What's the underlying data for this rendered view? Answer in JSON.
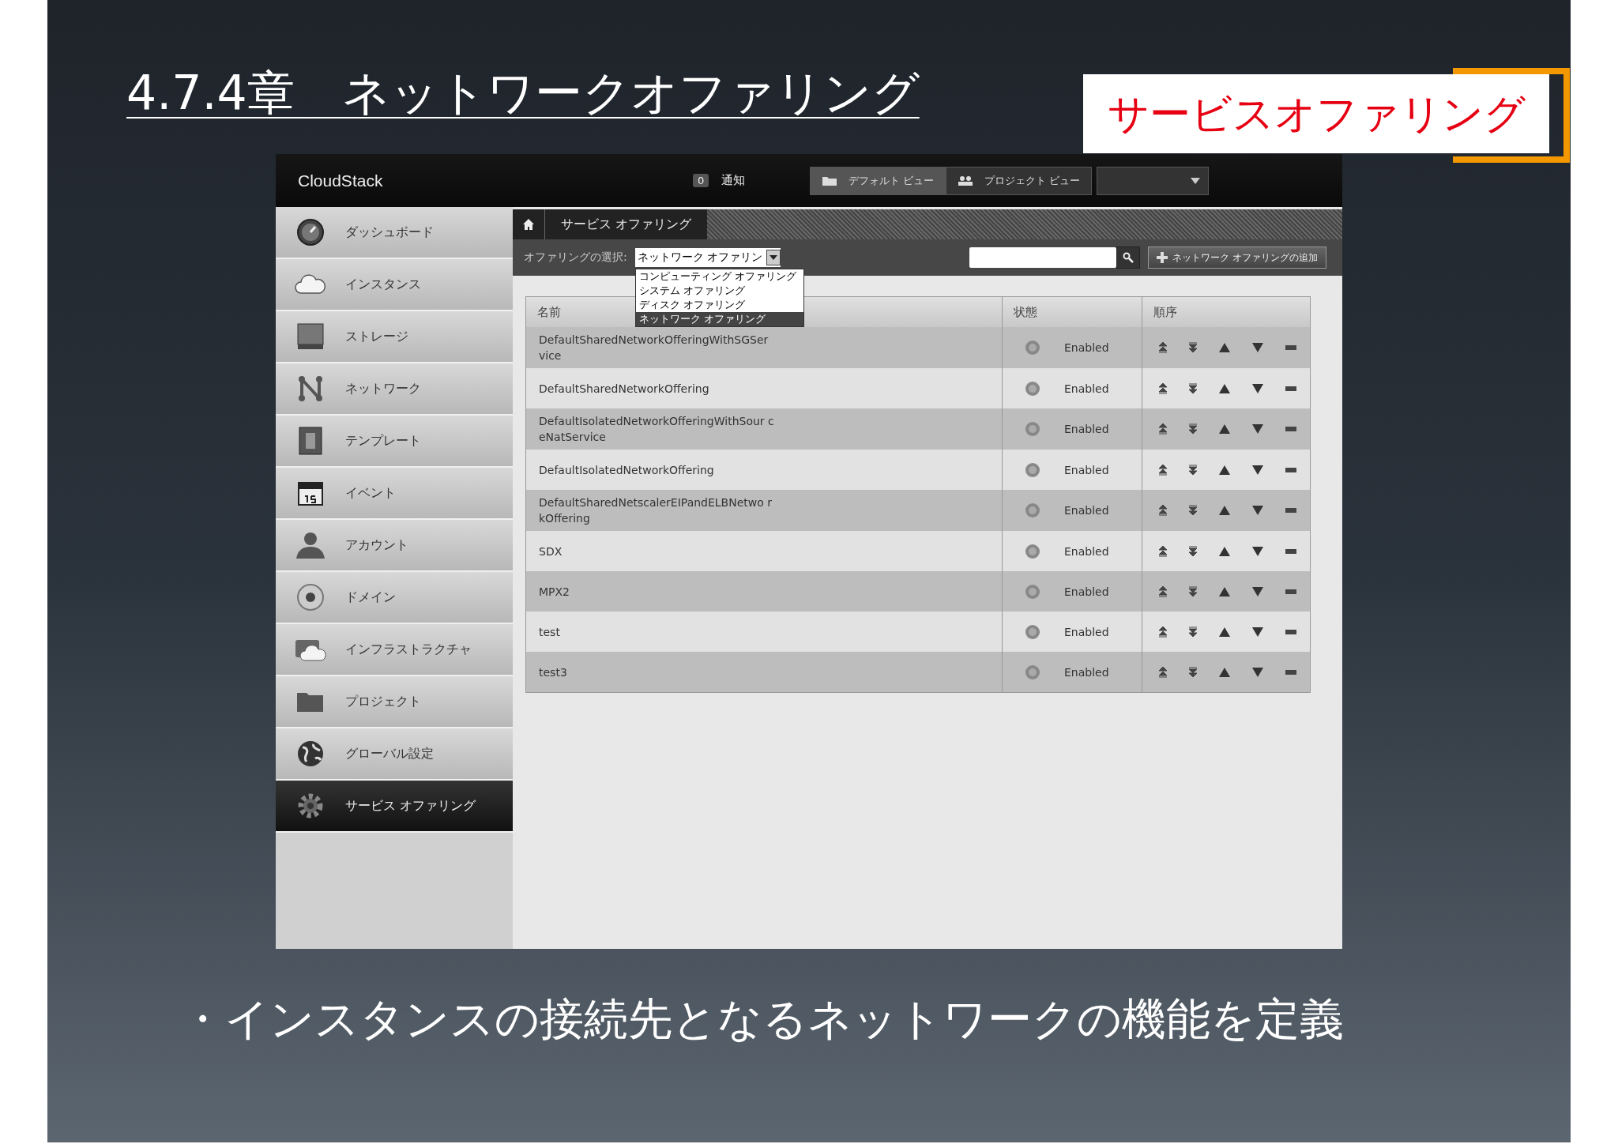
{
  "slide": {
    "title": "4.7.4章　ネットワークオファリング",
    "bullet": "・インスタンスの接続先となるネットワークの機能を定義",
    "callout": "サービスオファリング"
  },
  "app": {
    "logo": "CloudStack",
    "notification_count": "0",
    "notification_label": "通知",
    "view_buttons": [
      {
        "label": "デフォルト ビュー",
        "selected": true
      },
      {
        "label": "プロジェクト ビュー",
        "selected": false
      }
    ],
    "sidebar": [
      {
        "label": "ダッシュボード",
        "selected": false
      },
      {
        "label": "インスタンス",
        "selected": false
      },
      {
        "label": "ストレージ",
        "selected": false
      },
      {
        "label": "ネットワーク",
        "selected": false
      },
      {
        "label": "テンプレート",
        "selected": false
      },
      {
        "label": "イベント",
        "selected": false
      },
      {
        "label": "アカウント",
        "selected": false
      },
      {
        "label": "ドメイン",
        "selected": false
      },
      {
        "label": "インフラストラクチャ",
        "selected": false
      },
      {
        "label": "プロジェクト",
        "selected": false
      },
      {
        "label": "グローバル設定",
        "selected": false
      },
      {
        "label": "サービス オファリング",
        "selected": true
      }
    ],
    "breadcrumb": "サービス オファリング",
    "filter_label": "オファリングの選択:",
    "filter_value": "ネットワーク オファリン",
    "filter_options": [
      {
        "label": "コンピューティング オファリング",
        "selected": false
      },
      {
        "label": "システム オファリング",
        "selected": false
      },
      {
        "label": "ディスク オファリング",
        "selected": false
      },
      {
        "label": "ネットワーク オファリング",
        "selected": true
      }
    ],
    "add_button": "ネットワーク オファリングの追加",
    "table": {
      "columns": [
        "名前",
        "状態",
        "順序"
      ],
      "rows": [
        {
          "name": "DefaultSharedNetworkOfferingWithSGSer vice",
          "state": "Enabled"
        },
        {
          "name": "DefaultSharedNetworkOffering",
          "state": "Enabled"
        },
        {
          "name": "DefaultIsolatedNetworkOfferingWithSour ceNatService",
          "state": "Enabled"
        },
        {
          "name": "DefaultIsolatedNetworkOffering",
          "state": "Enabled"
        },
        {
          "name": "DefaultSharedNetscalerEIPandELBNetwo rkOffering",
          "state": "Enabled"
        },
        {
          "name": "SDX",
          "state": "Enabled"
        },
        {
          "name": "MPX2",
          "state": "Enabled"
        },
        {
          "name": "test",
          "state": "Enabled"
        },
        {
          "name": "test3",
          "state": "Enabled"
        }
      ]
    }
  }
}
